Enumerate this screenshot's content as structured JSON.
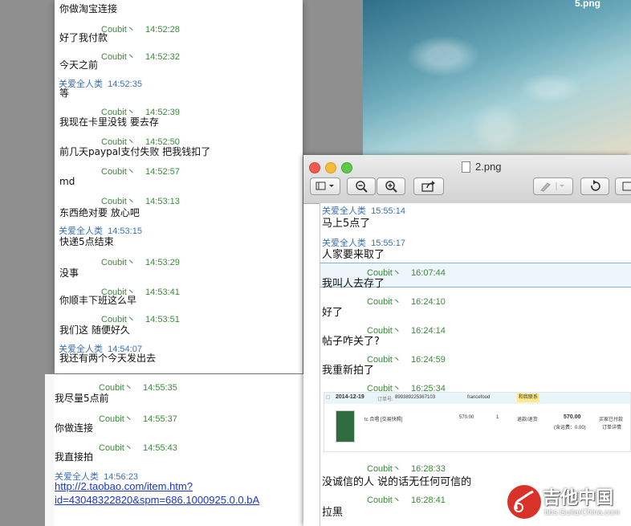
{
  "desktop": {
    "image_label": "5.png"
  },
  "chat1": {
    "lines": [
      {
        "kind": "msg",
        "text": "你做淘宝连接"
      },
      {
        "kind": "hdr-g",
        "name": "Coubit丶",
        "time": "14:52:28"
      },
      {
        "kind": "msg",
        "text": "好了我付款"
      },
      {
        "kind": "hdr-g",
        "name": "Coubit丶",
        "time": "14:52:32"
      },
      {
        "kind": "msg",
        "text": "今天之前"
      },
      {
        "kind": "hdr-b",
        "name": "关爱全人类",
        "time": "14:52:35"
      },
      {
        "kind": "msg",
        "text": "等"
      },
      {
        "kind": "hdr-g",
        "name": "Coubit丶",
        "time": "14:52:39"
      },
      {
        "kind": "msg",
        "text": "我现在卡里没钱 要去存"
      },
      {
        "kind": "hdr-g",
        "name": "Coubit丶",
        "time": "14:52:50"
      },
      {
        "kind": "msg",
        "text": "前几天paypal支付失败 把我钱扣了"
      },
      {
        "kind": "hdr-g",
        "name": "Coubit丶",
        "time": "14:52:57"
      },
      {
        "kind": "msg",
        "text": "md"
      },
      {
        "kind": "hdr-g",
        "name": "Coubit丶",
        "time": "14:53:13"
      },
      {
        "kind": "msg",
        "text": "东西绝对要  放心吧"
      },
      {
        "kind": "hdr-b",
        "name": "关爱全人类",
        "time": "14:53:15"
      },
      {
        "kind": "msg",
        "text": "快递5点结束"
      },
      {
        "kind": "hdr-g",
        "name": "Coubit丶",
        "time": "14:53:29"
      },
      {
        "kind": "msg",
        "text": "没事"
      },
      {
        "kind": "hdr-g",
        "name": "Coubit丶",
        "time": "14:53:41"
      },
      {
        "kind": "msg",
        "text": "你顺丰下班这么早"
      },
      {
        "kind": "hdr-g",
        "name": "Coubit丶",
        "time": "14:53:51"
      },
      {
        "kind": "msg",
        "text": "我们这 随便好久"
      },
      {
        "kind": "hdr-b",
        "name": "关爱全人类",
        "time": "14:54:07"
      },
      {
        "kind": "msg",
        "text": "我还有两个今天发出去"
      }
    ]
  },
  "chat2": {
    "lines": [
      {
        "kind": "hdr-g",
        "name": "Coubit丶",
        "time": "14:55:35"
      },
      {
        "kind": "msg",
        "text": "我尽量5点前"
      },
      {
        "kind": "hdr-g",
        "name": "Coubit丶",
        "time": "14:55:37"
      },
      {
        "kind": "msg",
        "text": "你做连接"
      },
      {
        "kind": "hdr-g",
        "name": "Coubit丶",
        "time": "14:55:43"
      },
      {
        "kind": "msg",
        "text": "我直接拍"
      },
      {
        "kind": "hdr-b",
        "name": "关爱全人类",
        "time": "14:56:23"
      },
      {
        "kind": "link",
        "text": "http://2.taobao.com/item.htm?"
      },
      {
        "kind": "link",
        "text": "id=43048322820&spm=686.1000925.0.0.bA"
      }
    ]
  },
  "preview": {
    "title": "2.png",
    "lines": [
      {
        "kind": "hdr-b",
        "name": "关爱全人类",
        "time": "15:55:14"
      },
      {
        "kind": "msg",
        "text": "马上5点了"
      },
      {
        "kind": "hdr-b",
        "name": "关爱全人类",
        "time": "15:55:17"
      },
      {
        "kind": "msg",
        "text": "人家要来取了"
      },
      {
        "kind": "hdr-g",
        "name": "Coubit丶",
        "time": "16:07:44"
      },
      {
        "kind": "msg",
        "text": "我叫人去存了"
      },
      {
        "kind": "hdr-g",
        "name": "Coubit丶",
        "time": "16:24:10"
      },
      {
        "kind": "msg",
        "text": "好了"
      },
      {
        "kind": "hdr-g",
        "name": "Coubit丶",
        "time": "16:24:14"
      },
      {
        "kind": "msg",
        "text": "帖子咋关了?"
      },
      {
        "kind": "hdr-g",
        "name": "Coubit丶",
        "time": "16:24:59"
      },
      {
        "kind": "msg",
        "text": "我重新拍了"
      },
      {
        "kind": "hdr-g",
        "name": "Coubit丶",
        "time": "16:25:34"
      },
      {
        "kind": "hdr-g",
        "name": "Coubit丶",
        "time": "16:28:33"
      },
      {
        "kind": "msg",
        "text": "没诚信的人 说的话无任何可信的"
      },
      {
        "kind": "hdr-g",
        "name": "Coubit丶",
        "time": "16:28:41"
      },
      {
        "kind": "msg",
        "text": "拉黑"
      }
    ],
    "order": {
      "date": "2014-12-19",
      "order_label": "订单号:",
      "order_no": "899389225367103",
      "shop": "francefood",
      "badge": "和我联系",
      "item": "tc 合唱 [交易快照]",
      "price": "570.00",
      "qty": "1",
      "action": "退款/退货",
      "total": "570.00",
      "shipping": "(含运费：0.00)",
      "status": "买家已付款",
      "detail": "订单详情"
    }
  },
  "watermark": {
    "title": "吉他中国",
    "sub": "bbs.GuitarChina.com"
  }
}
